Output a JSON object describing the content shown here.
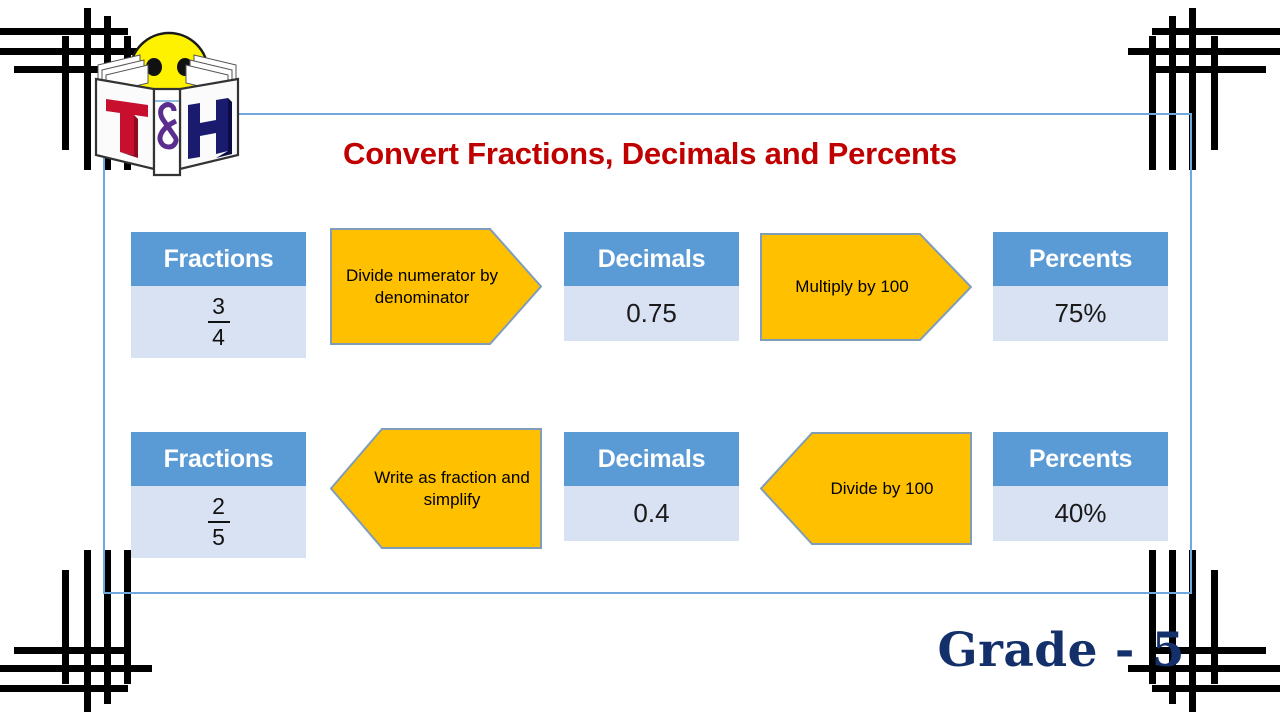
{
  "slide": {
    "title": "Convert Fractions, Decimals and Percents",
    "grade_label": "Grade - 5",
    "logo_letters": {
      "left": "T",
      "middle": "&",
      "right": "H"
    }
  },
  "colors": {
    "title_red": "#C00000",
    "header_blue": "#5B9BD5",
    "body_blue": "#D9E2F3",
    "arrow_orange": "#FFC000",
    "arrow_border": "#7F9DB9",
    "content_border_blue": "#6FA8DC",
    "grade_navy": "#14306B",
    "frame_black": "#000000"
  },
  "rows": [
    {
      "direction": "right",
      "fraction": {
        "header": "Fractions",
        "numerator": "3",
        "denominator": "4"
      },
      "arrow_1": "Divide numerator by denominator",
      "decimal": {
        "header": "Decimals",
        "value": "0.75"
      },
      "arrow_2": "Multiply by 100",
      "percent": {
        "header": "Percents",
        "value": "75%"
      }
    },
    {
      "direction": "left",
      "fraction": {
        "header": "Fractions",
        "numerator": "2",
        "denominator": "5"
      },
      "arrow_1": "Write as fraction and simplify",
      "decimal": {
        "header": "Decimals",
        "value": "0.4"
      },
      "arrow_2": "Divide by 100",
      "percent": {
        "header": "Percents",
        "value": "40%"
      }
    }
  ]
}
